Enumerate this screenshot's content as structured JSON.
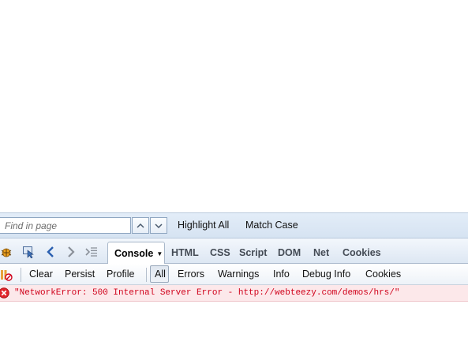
{
  "findbar": {
    "placeholder": "Find in page",
    "highlight_all": "Highlight All",
    "match_case": "Match Case"
  },
  "firebug": {
    "icons": [
      "firebug-icon",
      "inspect-icon",
      "back-icon",
      "forward-icon",
      "command-line-icon"
    ],
    "tabs": [
      "Console",
      "HTML",
      "CSS",
      "Script",
      "DOM",
      "Net",
      "Cookies"
    ],
    "active_tab": "Console"
  },
  "console_toolbar": {
    "buttons": [
      "Clear",
      "Persist",
      "Profile"
    ],
    "filters": [
      "All",
      "Errors",
      "Warnings",
      "Info",
      "Debug Info",
      "Cookies"
    ],
    "active_filter": "All"
  },
  "log": [
    {
      "type": "error",
      "text": "\"NetworkError: 500 Internal Server Error - http://webteezy.com/demos/hrs/\""
    }
  ],
  "colors": {
    "error_text": "#d0021b",
    "error_row_bg": "#fce8ea",
    "findbar_bg": "#dde8f5"
  }
}
